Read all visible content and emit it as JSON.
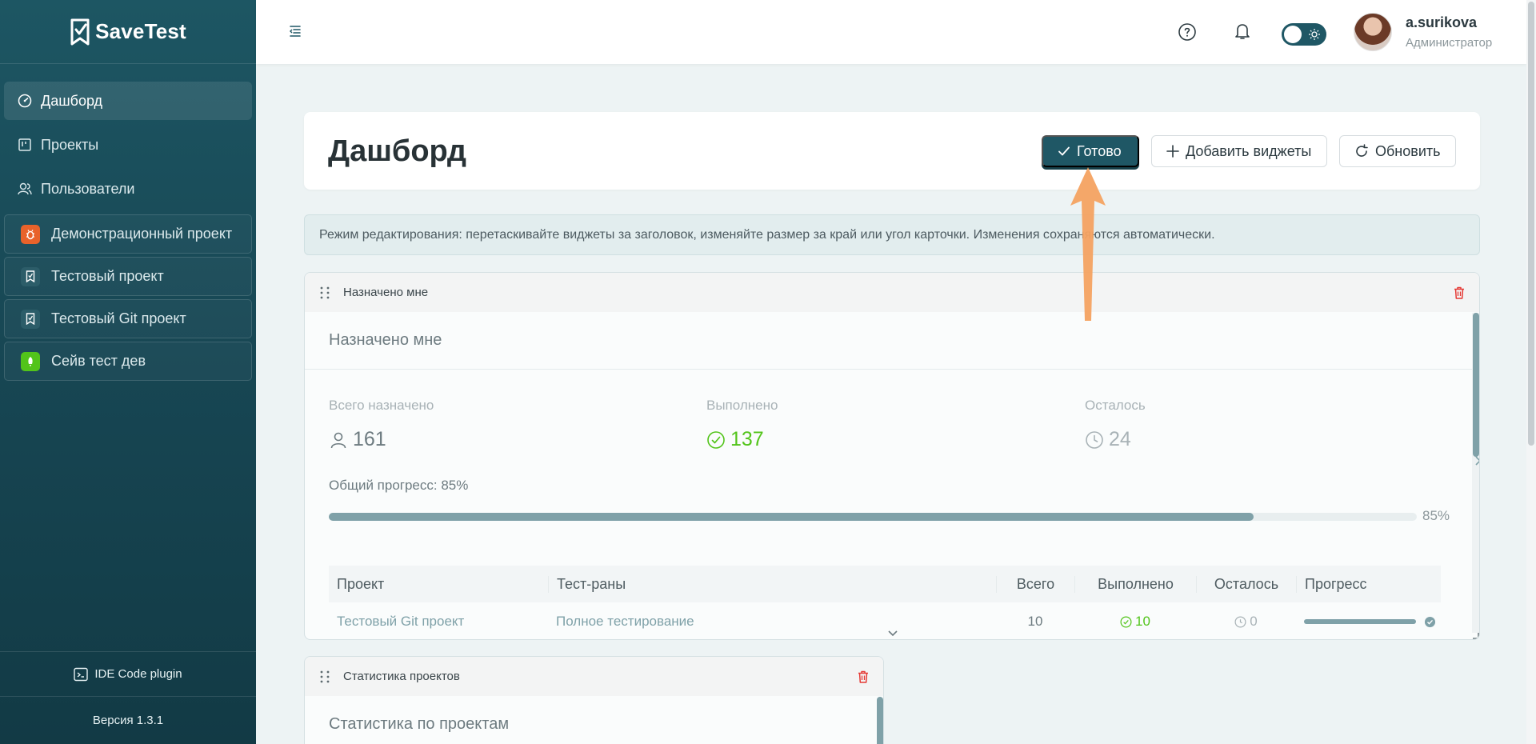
{
  "brand": {
    "name": "SaveTest"
  },
  "nav": [
    {
      "label": "Дашборд",
      "icon": "dashboard-icon",
      "active": true
    },
    {
      "label": "Проекты",
      "icon": "projects-icon",
      "active": false
    },
    {
      "label": "Пользователи",
      "icon": "users-icon",
      "active": false
    }
  ],
  "projects": [
    {
      "label": "Демонстрационный проект",
      "icon": "bug-icon",
      "color": "#e8622a"
    },
    {
      "label": "Тестовый проект",
      "icon": "project-logo-icon",
      "color": "#2c5d69"
    },
    {
      "label": "Тестовый Git проект",
      "icon": "project-logo-icon",
      "color": "#2c5d69"
    },
    {
      "label": "Сейв тест дев",
      "icon": "rocket-icon",
      "color": "#52c41a"
    }
  ],
  "footer": {
    "plugin_label": "IDE Code plugin",
    "version": "Версия 1.3.1"
  },
  "user": {
    "name": "a.surikova",
    "role": "Администратор"
  },
  "header": {
    "title": "Дашборд",
    "done_label": "Готово",
    "add_widgets_label": "Добавить виджеты",
    "refresh_label": "Обновить"
  },
  "banner": {
    "text": "Режим редактирования: перетаскивайте виджеты за заголовок, изменяйте размер за край или угол карточки. Изменения сохраняются автоматически."
  },
  "assigned_widget": {
    "header": "Назначено мне",
    "title": "Назначено мне",
    "stats": {
      "total_label": "Всего назначено",
      "total_value": "161",
      "done_label": "Выполнено",
      "done_value": "137",
      "left_label": "Осталось",
      "left_value": "24"
    },
    "progress": {
      "label": "Общий прогресс: 85%",
      "percent": 85,
      "percent_label": "85%"
    },
    "table": {
      "headers": [
        "Проект",
        "Тест-раны",
        "Всего",
        "Выполнено",
        "Осталось",
        "Прогресс"
      ],
      "rows": [
        {
          "project": "Тестовый Git проект",
          "run": "Полное тестирование",
          "total": "10",
          "done": "10",
          "left": "0",
          "progress": 100
        }
      ]
    }
  },
  "projects_widget": {
    "header": "Статистика проектов",
    "title": "Статистика по проектам"
  },
  "colors": {
    "accent": "#1f5765",
    "success": "#52c41a",
    "danger": "#e53935",
    "annotation_arrow": "#f4a261"
  }
}
